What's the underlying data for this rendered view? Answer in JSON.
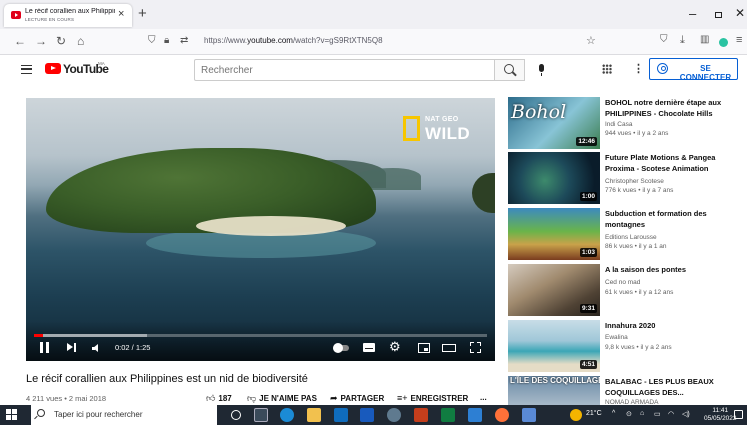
{
  "browser": {
    "tab_title": "Le récif corallien aux Philippines",
    "tab_subtitle": "LECTURE EN COURS",
    "tab_close": "×",
    "new_tab": "+",
    "url_prefix": "https://www.",
    "url_domain": "youtube.com",
    "url_path": "/watch?v=gS9RtXTN5Q8"
  },
  "header": {
    "logo_text": "YouTube",
    "country_code": "MA",
    "search_placeholder": "Rechercher",
    "more_glyph": "⋮",
    "signin_label": "SE CONNECTER"
  },
  "player": {
    "brand_line1": "NAT GEO",
    "brand_line2": "WILD",
    "time": "0:02 / 1:25",
    "progress": 0.02,
    "buffered": 0.25
  },
  "video": {
    "title": "Le récif corallien aux Philippines est un nid de biodiversité",
    "meta": "4 211 vues • 2 mai 2018",
    "likes": "187",
    "dislike_label": "JE N'AIME PAS",
    "share_label": "PARTAGER",
    "save_label": "ENREGISTRER",
    "more_label": "..."
  },
  "recommendations": [
    {
      "title": "BOHOL notre dernière étape aux PHILIPPINES - Chocolate Hills",
      "channel": "Indi Casa",
      "views": "944 vues • il y a 2 ans",
      "duration": "12:46",
      "thumb_caption": "Bohol"
    },
    {
      "title": "Future Plate Motions & Pangea Proxima - Scotese Animation",
      "channel": "Christopher Scotese",
      "views": "776 k vues • il y a 7 ans",
      "duration": "1:00",
      "thumb_caption": ""
    },
    {
      "title": "Subduction et formation des montagnes",
      "channel": "Editions Larousse",
      "views": "86 k vues • il y a 1 an",
      "duration": "1:03",
      "thumb_caption": ""
    },
    {
      "title": "A la saison des pontes",
      "channel": "Ced no mad",
      "views": "61 k vues • il y a 12 ans",
      "duration": "9:31",
      "thumb_caption": ""
    },
    {
      "title": "Innahura 2020",
      "channel": "Ewalina",
      "views": "9,8 k vues • il y a 2 ans",
      "duration": "4:51",
      "thumb_caption": ""
    },
    {
      "title": "BALABAC - LES PLUS BEAUX COQUILLAGES DES...",
      "channel": "NOMAD ARMADA",
      "views": "",
      "duration": "",
      "thumb_caption": "L'ÎLE DES COQUILLAGES"
    }
  ],
  "taskbar": {
    "search_label": "Taper ici pour rechercher",
    "weather": "21°C",
    "time": "11:41",
    "date": "05/05/2022"
  }
}
